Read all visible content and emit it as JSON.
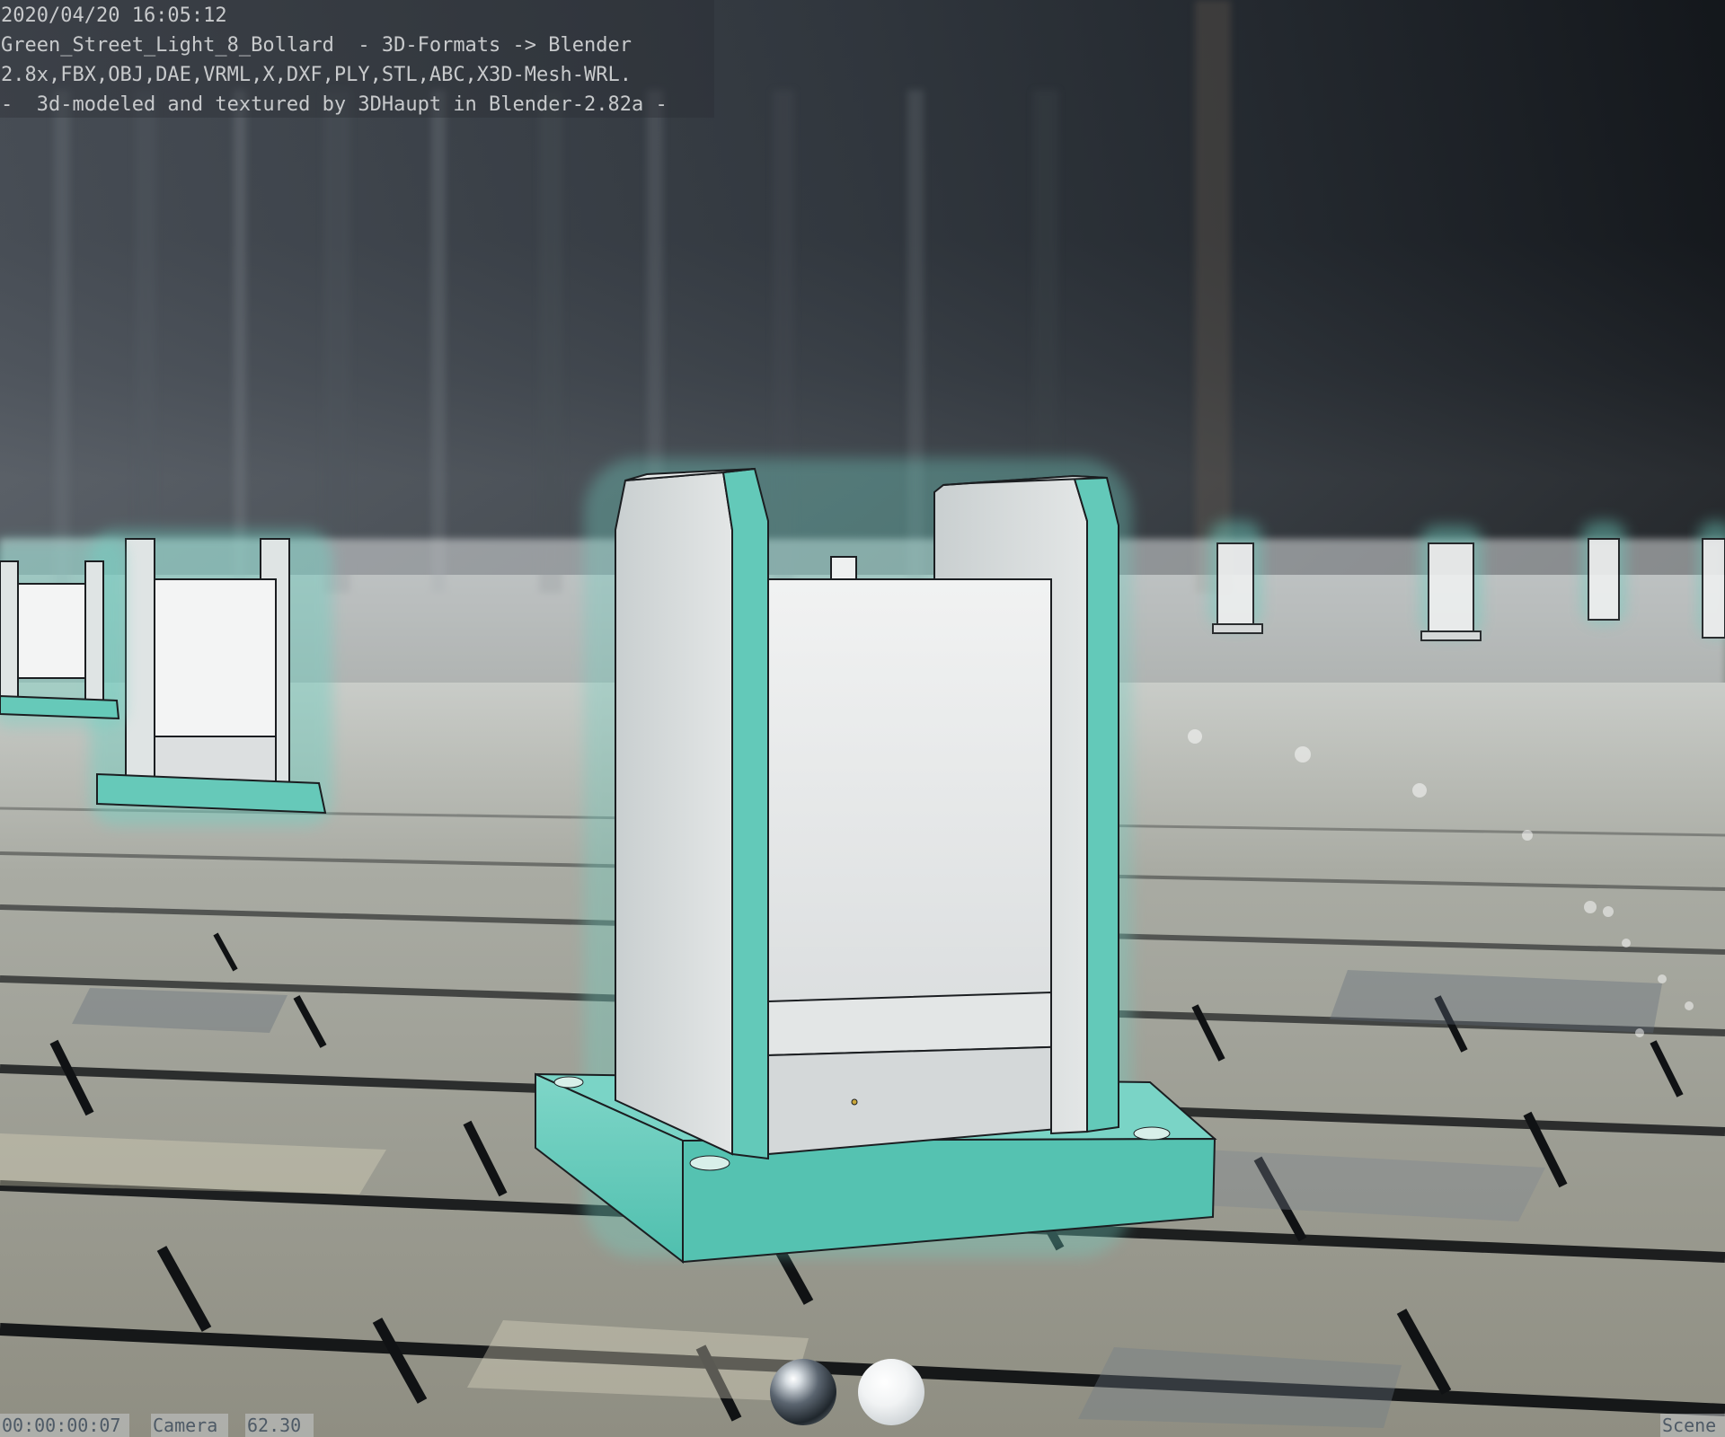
{
  "stamp": {
    "line1": "2020/04/20 16:05:12",
    "line2": "Green_Street_Light_8_Bollard  - 3D-Formats -> Blender",
    "line3": "2.8x,FBX,OBJ,DAE,VRML,X,DXF,PLY,STL,ABC,X3D-Mesh-WRL.",
    "line4": "-  3d-modeled and textured by 3DHaupt in Blender-2.82a -"
  },
  "status": {
    "frame_time": "00:00:00:07",
    "camera": "Camera",
    "lens": "62.30",
    "scene": "Scene"
  },
  "colors": {
    "accent_teal": "#5fc8b8",
    "panel_white": "#e9ebec",
    "tile_light": "#d6d2bd",
    "tile_dark": "#121416"
  },
  "icons": {
    "glossy_sphere": "glossy-matcap-sphere-icon",
    "matte_sphere": "matte-matcap-sphere-icon"
  }
}
